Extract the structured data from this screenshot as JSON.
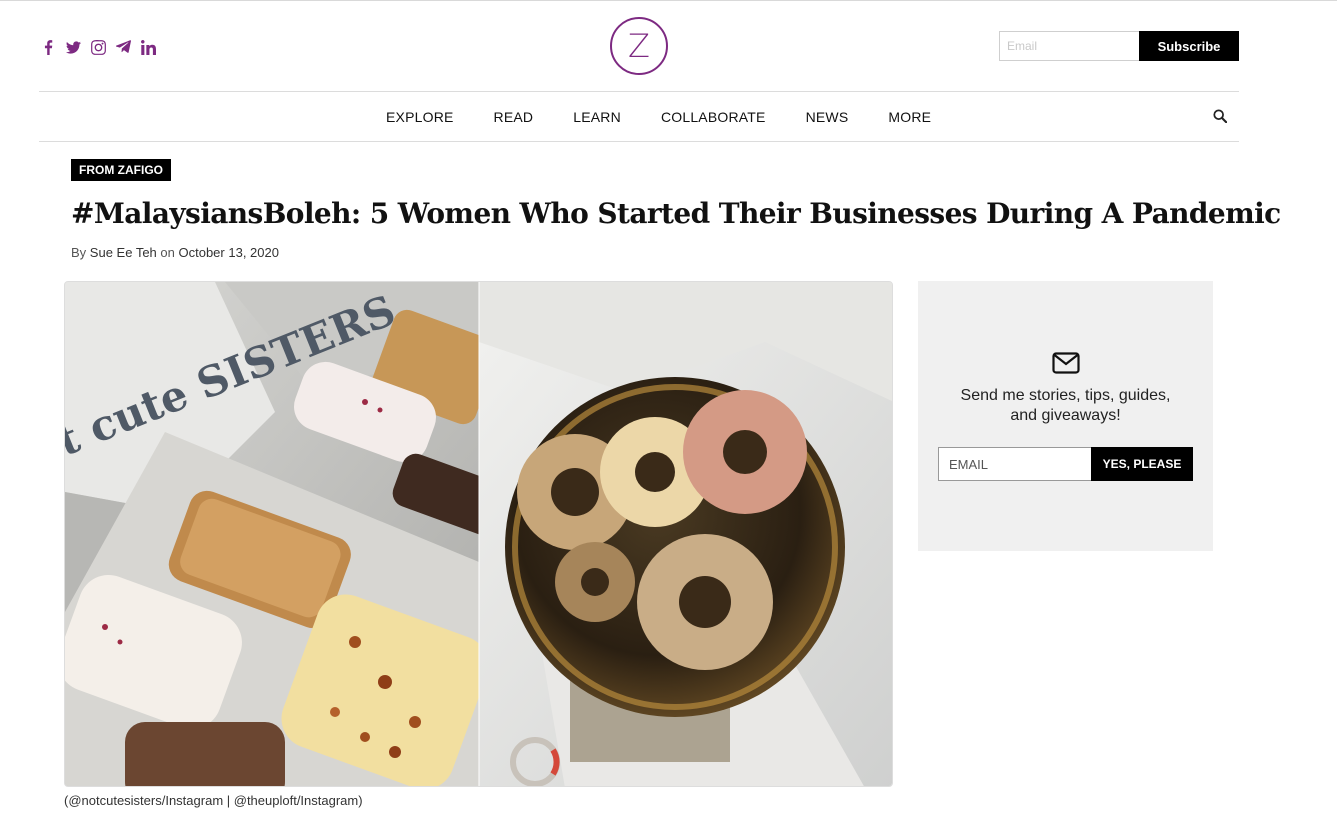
{
  "header": {
    "social": [
      {
        "name": "facebook",
        "icon": "facebook-icon"
      },
      {
        "name": "twitter",
        "icon": "twitter-icon"
      },
      {
        "name": "instagram",
        "icon": "instagram-icon"
      },
      {
        "name": "telegram",
        "icon": "telegram-icon"
      },
      {
        "name": "linkedin",
        "icon": "linkedin-icon"
      }
    ],
    "logo_letter": "Z",
    "brand_color": "#7d2a82",
    "subscribe": {
      "placeholder": "Email",
      "button_label": "Subscribe"
    }
  },
  "nav": {
    "items": [
      "EXPLORE",
      "READ",
      "LEARN",
      "COLLABORATE",
      "NEWS",
      "MORE"
    ],
    "search_icon": "search-icon"
  },
  "article": {
    "category": "FROM ZAFIGO",
    "title": "#MalaysiansBoleh: 5 Women Who Started Their Businesses During A Pandemic",
    "byline": {
      "by": "By",
      "author": "Sue Ee Teh",
      "on": "on",
      "date": "October 13, 2020"
    },
    "hero_caption": "(@notcutesisters/Instagram | @theuploft/Instagram)",
    "hero_box_print": "t cute SISTERS."
  },
  "sidebar": {
    "signup": {
      "icon": "envelope-icon",
      "text_line1": "Send me stories, tips, guides,",
      "text_line2": "and giveaways!",
      "placeholder": "EMAIL",
      "button_label": "YES, PLEASE"
    }
  }
}
